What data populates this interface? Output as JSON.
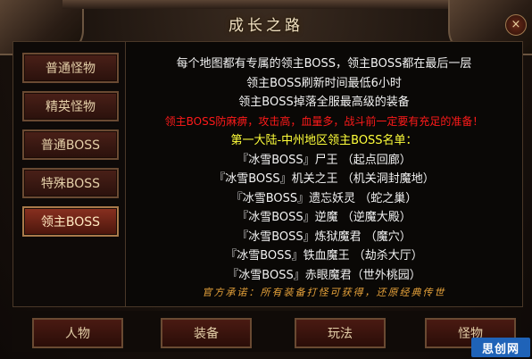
{
  "window": {
    "title": "成长之路",
    "close_icon": "×"
  },
  "sidebar": {
    "items": [
      {
        "label": "普通怪物"
      },
      {
        "label": "精英怪物"
      },
      {
        "label": "普通BOSS"
      },
      {
        "label": "特殊BOSS"
      },
      {
        "label": "领主BOSS",
        "active": true
      }
    ]
  },
  "content": {
    "intro": [
      "每个地图都有专属的领主BOSS，领主BOSS都在最后一层",
      "领主BOSS刷新时间最低6小时",
      "领主BOSS掉落全服最高级的装备"
    ],
    "warning": "领主BOSS防麻痹，攻击高，血量多，战斗前一定要有充足的准备！",
    "list_heading": "第一大陆-中州地区领主BOSS名单：",
    "bosses": [
      "『冰雪BOSS』尸王 （起点回廊）",
      "『冰雪BOSS』机关之王 （机关洞封魔地）",
      "『冰雪BOSS』遗忘妖灵 （蛇之巢）",
      "『冰雪BOSS』逆魔 （逆魔大殿）",
      "『冰雪BOSS』炼狱魔君 （魔穴）",
      "『冰雪BOSS』铁血魔王 （劫杀大厅）",
      "『冰雪BOSS』赤眼魔君（世外桃园）"
    ],
    "footer_note": "官方承诺：所有装备打怪可获得，还原经典传世"
  },
  "bottom_tabs": [
    {
      "label": "人物"
    },
    {
      "label": "装备"
    },
    {
      "label": "玩法"
    },
    {
      "label": "怪物"
    }
  ],
  "watermark": "思创网",
  "colors": {
    "warning": "#ff1a1a",
    "heading": "#ffff3a",
    "footer_note": "#e6a23a",
    "body_text": "#f2f2f2",
    "active_tab": "#8a3020"
  }
}
